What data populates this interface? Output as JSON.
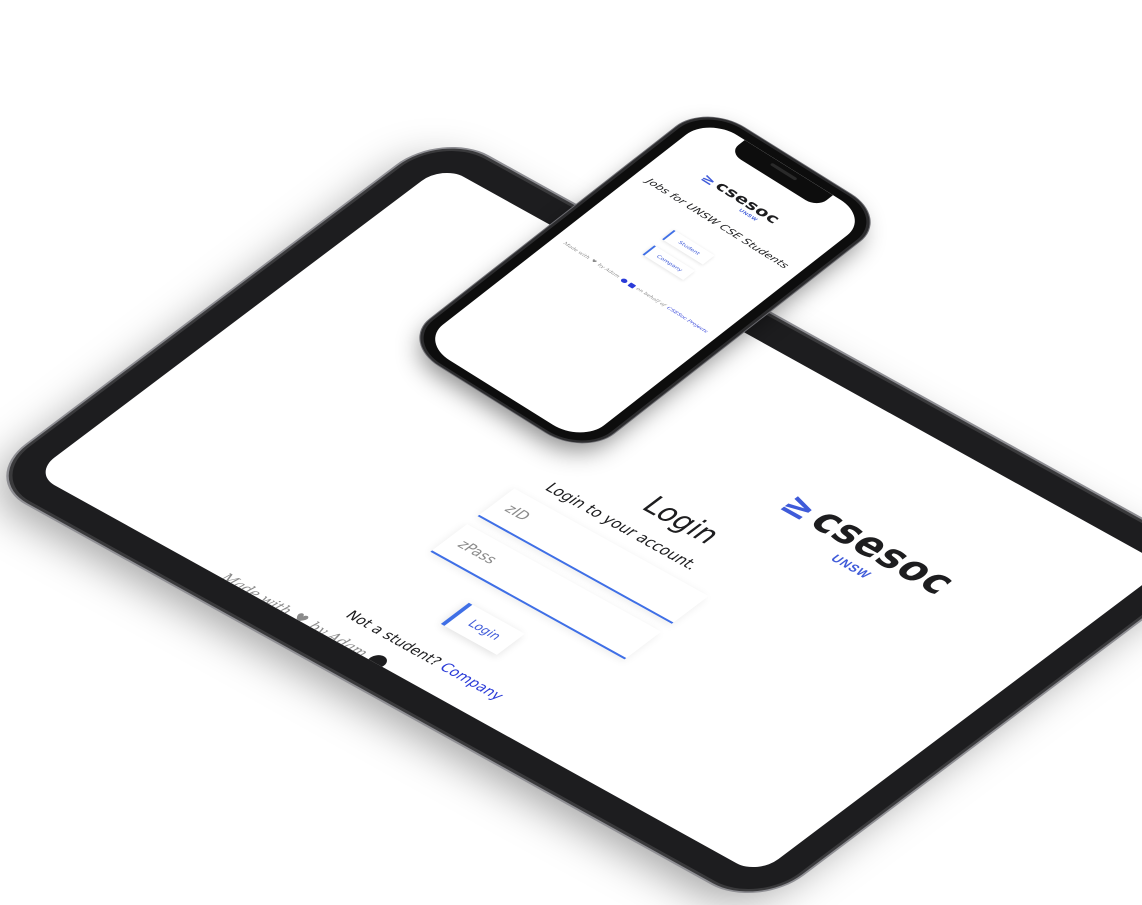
{
  "tablet": {
    "logo": {
      "mark": "≥",
      "text": "csesoc",
      "sub": "UNSW"
    },
    "title": "Login",
    "subtitle": "Login to your account.",
    "zid_placeholder": "zID",
    "zpass_placeholder": "zPass",
    "login_label": "Login",
    "not_student_text": "Not a student?",
    "company_link": "Company",
    "footer": {
      "made_with": "Made with",
      "by": "by Adam"
    }
  },
  "phone": {
    "logo": {
      "mark": "≥",
      "text": "csesoc",
      "sub": "UNSW"
    },
    "title": "Jobs for UNSW CSE Students",
    "student_label": "Student",
    "company_label": "Company",
    "footer": {
      "made_with": "Made with",
      "by": "by Adam",
      "on_behalf": "on behalf of",
      "link": "CSESoc Projects"
    }
  },
  "colors": {
    "accent": "#3f6fe6",
    "link": "#2a3bd8",
    "device_frame": "#1d1d1f"
  }
}
